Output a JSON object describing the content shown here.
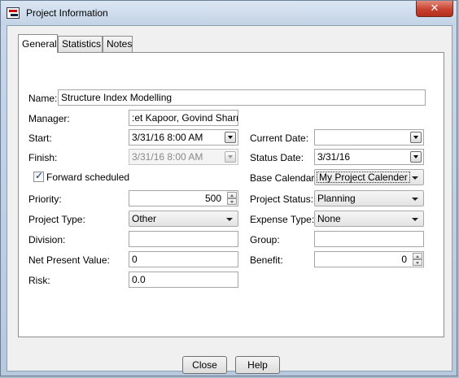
{
  "window": {
    "title": "Project Information",
    "close_glyph": "✕"
  },
  "tabs": [
    {
      "label": "General"
    },
    {
      "label": "Statistics"
    },
    {
      "label": "Notes"
    }
  ],
  "form": {
    "name": {
      "label": "Name:",
      "value": "Structure Index Modelling"
    },
    "manager": {
      "label": "Manager:",
      "value": ":et Kapoor, Govind Sharma"
    },
    "start": {
      "label": "Start:",
      "value": "3/31/16 8:00 AM"
    },
    "finish": {
      "label": "Finish:",
      "value": "3/31/16 8:00 AM"
    },
    "forward": {
      "label": "Forward scheduled",
      "checked": true
    },
    "priority": {
      "label": "Priority:",
      "value": "500"
    },
    "project_type": {
      "label": "Project Type:",
      "value": "Other"
    },
    "division": {
      "label": "Division:",
      "value": ""
    },
    "npv": {
      "label": "Net Present Value:",
      "value": "0"
    },
    "risk": {
      "label": "Risk:",
      "value": "0.0"
    },
    "current_date": {
      "label": "Current Date:",
      "value": ""
    },
    "status_date": {
      "label": "Status Date:",
      "value": "3/31/16"
    },
    "base_calendar": {
      "label": "Base Calendar:",
      "value": "My Project Calender"
    },
    "project_status": {
      "label": "Project Status:",
      "value": "Planning"
    },
    "expense_type": {
      "label": "Expense Type:",
      "value": "None"
    },
    "group": {
      "label": "Group:",
      "value": ""
    },
    "benefit": {
      "label": "Benefit:",
      "value": "0"
    }
  },
  "buttons": {
    "close": "Close",
    "help": "Help"
  },
  "icons": {
    "app": "project-app-icon",
    "dropdown": "chevron-down-icon",
    "spinner": "spinner-arrows-icon",
    "check": "checkmark-icon"
  },
  "colors": {
    "title_bar": "#c9d7e8",
    "close_button": "#c8412f",
    "panel_bg": "#ffffff",
    "dialog_bg": "#f0f0f0"
  }
}
